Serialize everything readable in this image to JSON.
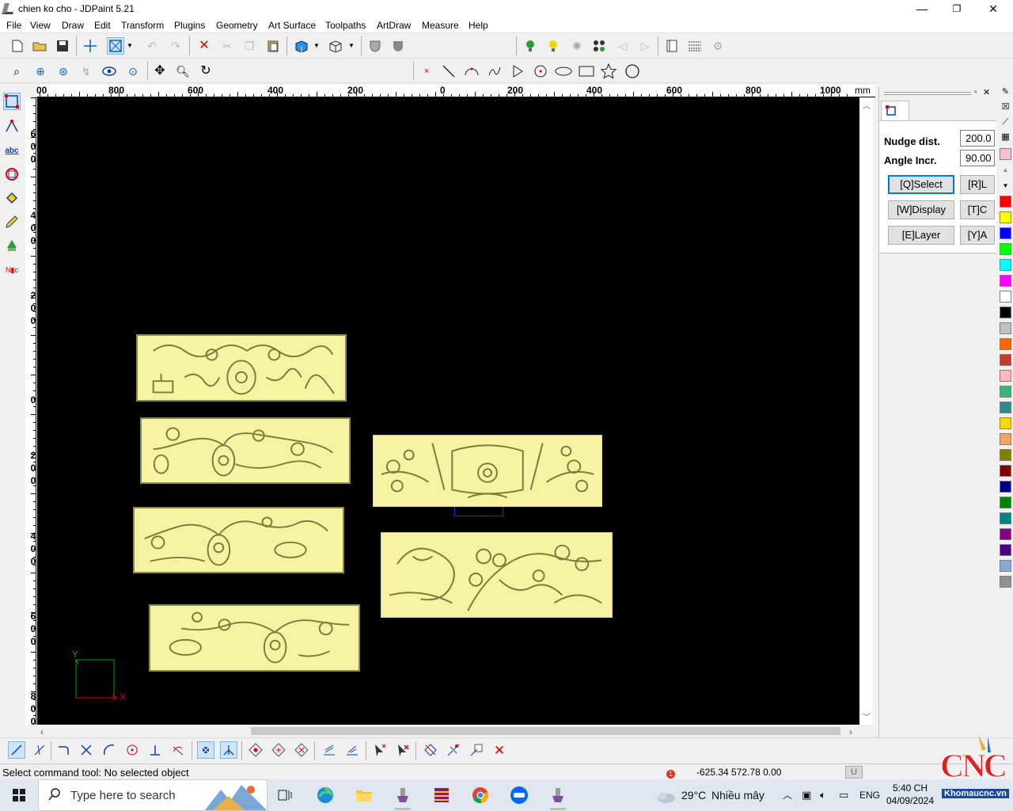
{
  "window": {
    "title": "chien ko cho - JDPaint 5.21",
    "minimize": "—",
    "maximize": "❐",
    "close": "✕"
  },
  "menu": [
    "File",
    "View",
    "Draw",
    "Edit",
    "Transform",
    "Plugins",
    "Geometry",
    "Art Surface",
    "Toolpaths",
    "ArtDraw",
    "Measure",
    "Help"
  ],
  "ruler_h": {
    "labels": [
      "00",
      "800",
      "600",
      "400",
      "200",
      "0",
      "200",
      "400",
      "600",
      "800",
      "1000"
    ],
    "unit": "mm"
  },
  "ruler_v": {
    "labels": [
      [
        "6",
        "0",
        "0"
      ],
      [
        "4",
        "0",
        "0"
      ],
      [
        "2",
        "0",
        "0"
      ],
      [
        "0"
      ],
      [
        "2",
        "0",
        "0"
      ],
      [
        "4",
        "0",
        "0"
      ],
      [
        "6",
        "0",
        "0"
      ],
      [
        "8",
        "0",
        "0"
      ]
    ]
  },
  "axes": {
    "x": "X",
    "y": "Y"
  },
  "panel": {
    "nudge_label": "Nudge dist.",
    "nudge_value": "200.0",
    "angle_label": "Angle Incr.",
    "angle_value": "90.00",
    "buttons": [
      "[Q]Select",
      "[R]L",
      "[W]Display",
      "[T]C",
      "[E]Layer",
      "[Y]A"
    ]
  },
  "palette": [
    "#ff0000",
    "#ffff00",
    "#0000ff",
    "#00ff00",
    "#00ffff",
    "#ff00ff",
    "#ffffff",
    "#000000",
    "#c0c0c0",
    "#ff6600",
    "#c0392b",
    "#ffb6c1",
    "#3cb371",
    "#2e8b8b",
    "#ffd700",
    "#f4a460",
    "#808000",
    "#800000",
    "#000080",
    "#008000",
    "#008080",
    "#800080",
    "#4b0082",
    "#87a9d0",
    "#909090"
  ],
  "status": {
    "message": "Select command tool: No selected object",
    "coords": "-625.34 572.78 0.00",
    "mode": "U"
  },
  "taskbar": {
    "search_placeholder": "Type here to search",
    "weather_temp": "29°C",
    "weather_desc": "Nhiều mây",
    "weather_badge": "1",
    "lang": "ENG",
    "time": "5:40 CH",
    "date": "04/09/2024"
  },
  "watermark": {
    "brand": "CNC",
    "site": "Khomaucnc.vn"
  }
}
